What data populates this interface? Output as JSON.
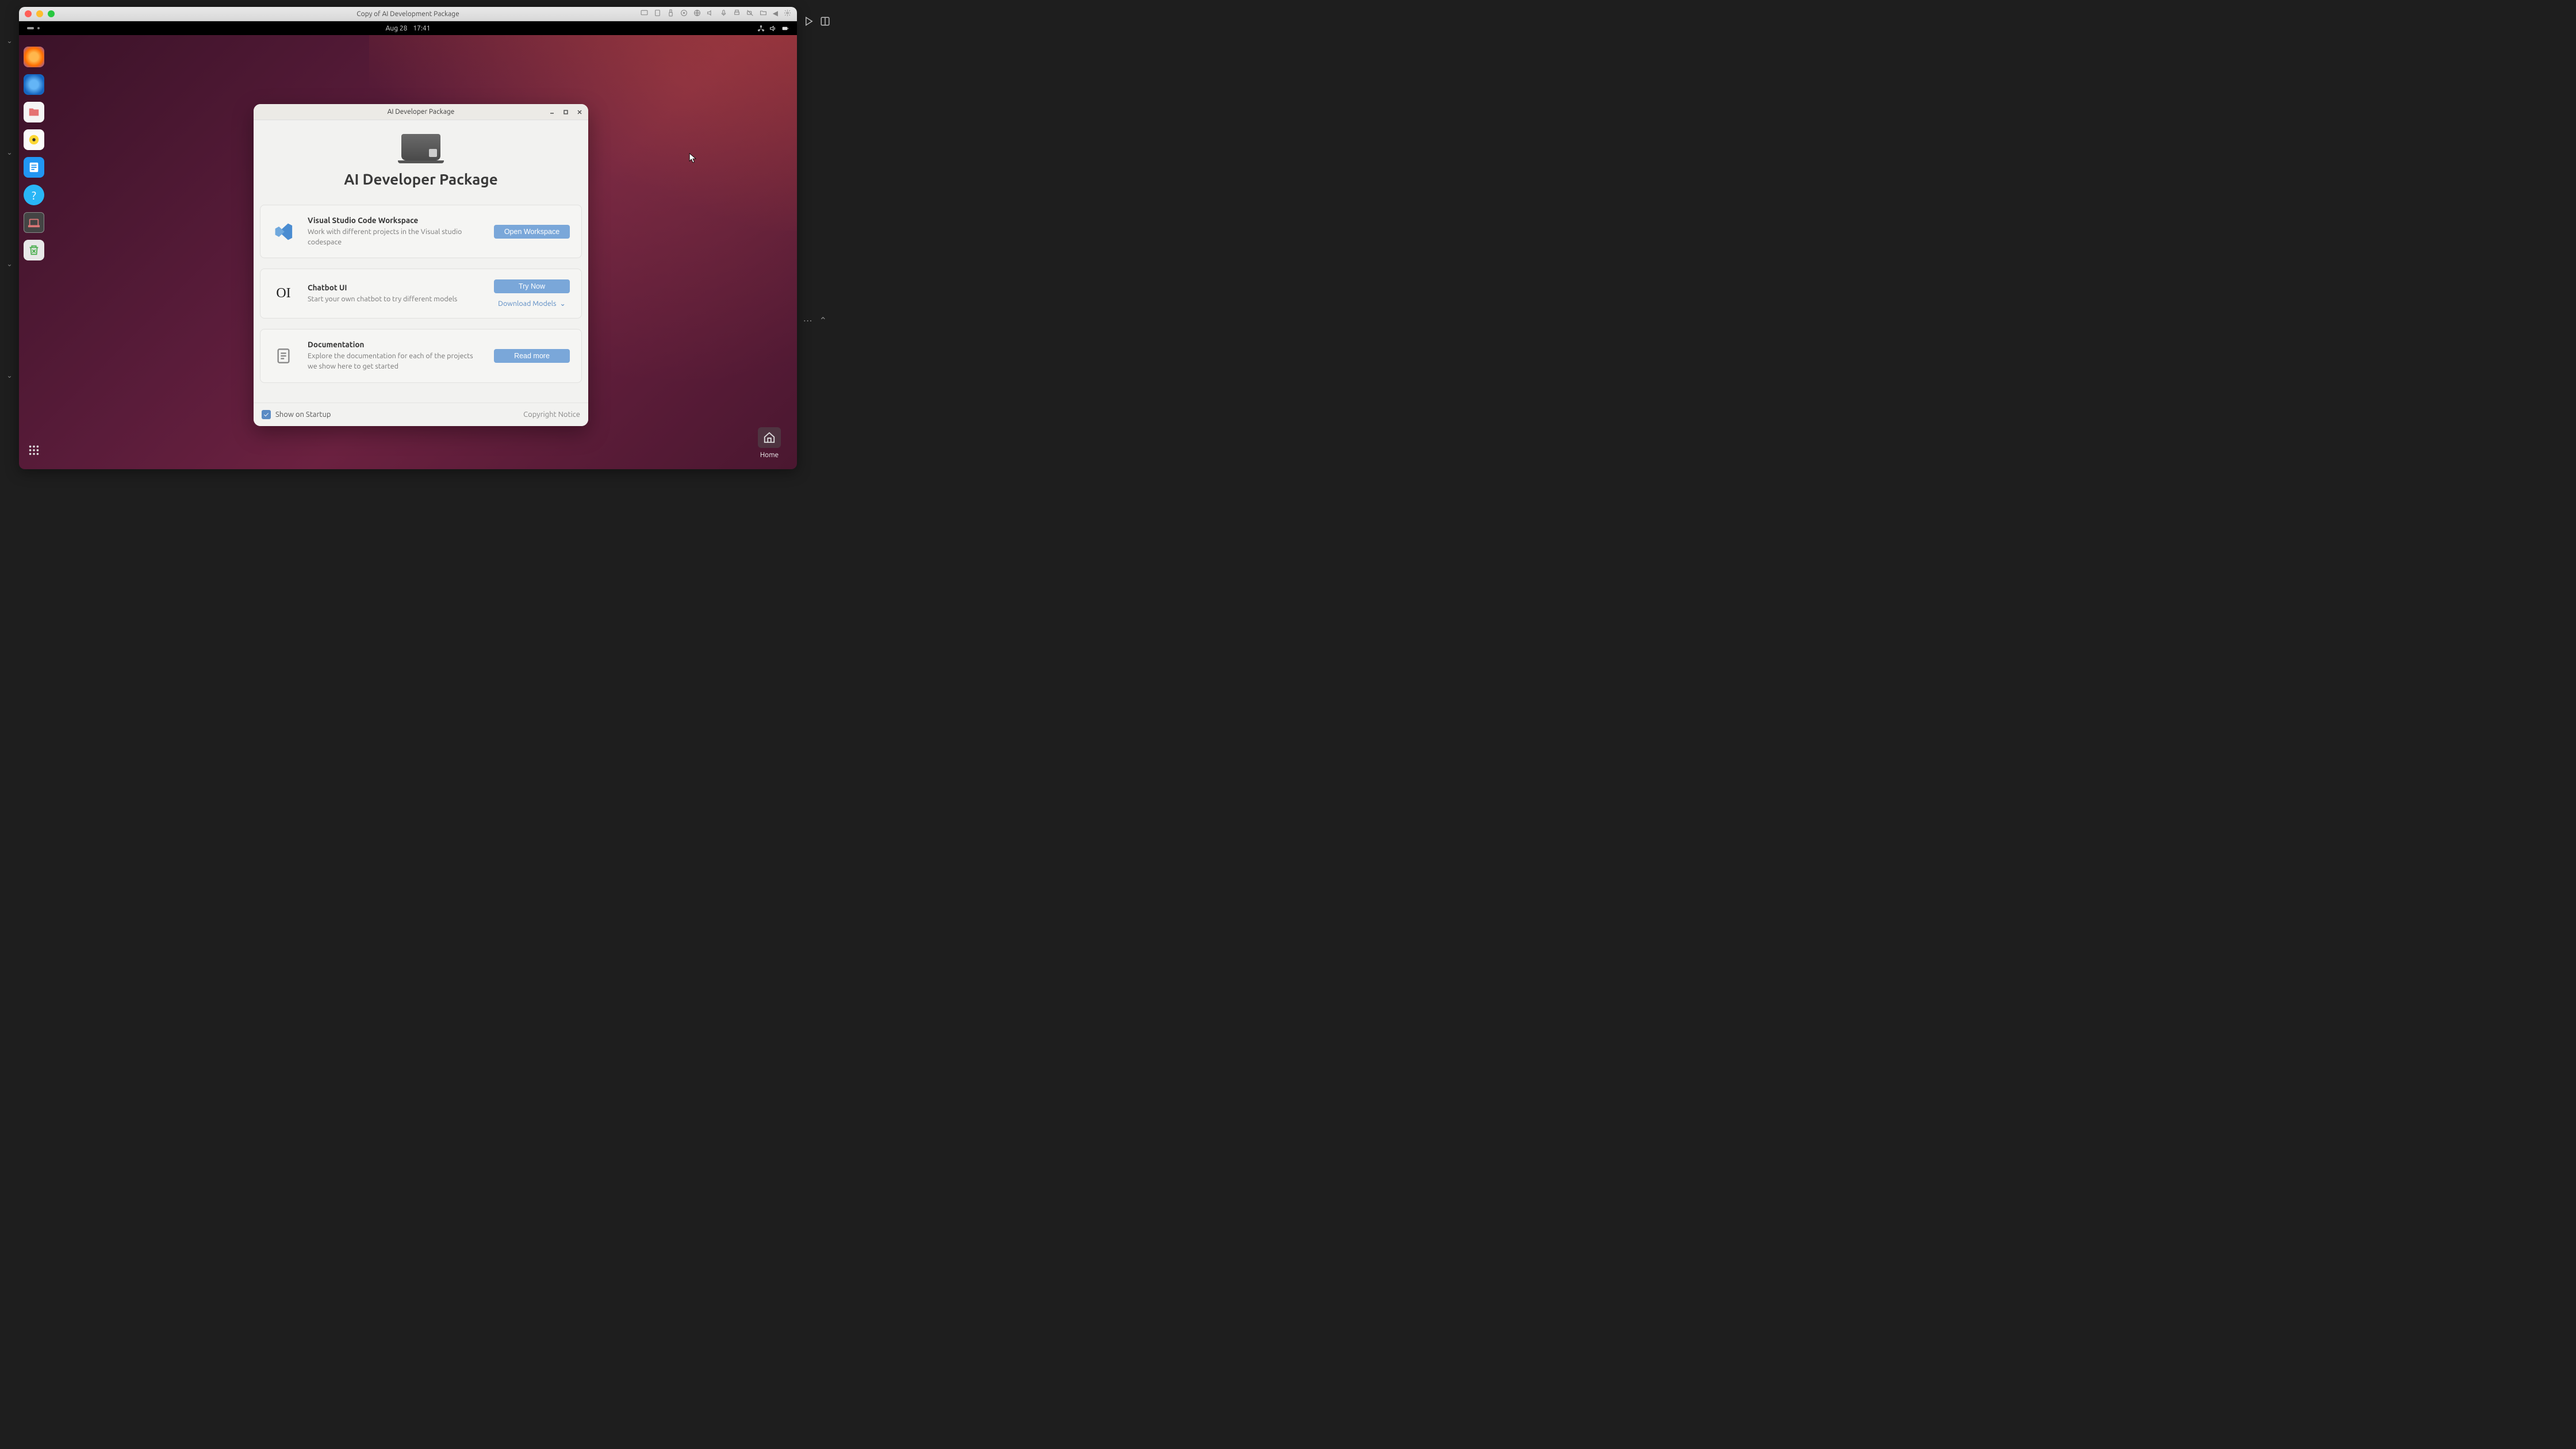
{
  "mac_titlebar": {
    "title": "Copy of AI Development Package"
  },
  "ubuntu_topbar": {
    "date": "Aug 28",
    "time": "17:41"
  },
  "desktop": {
    "home_label": "Home"
  },
  "dialog": {
    "titlebar": "AI Developer Package",
    "hero_title": "AI Developer Package",
    "cards": {
      "vscode": {
        "title": "Visual Studio Code Workspace",
        "subtitle": "Work with different projects in the Visual studio codespace",
        "button": "Open Workspace"
      },
      "chatbot": {
        "title": "Chatbot UI",
        "subtitle": "Start your own chatbot to try different models",
        "button": "Try Now",
        "download_link": "Download Models"
      },
      "docs": {
        "title": "Documentation",
        "subtitle": "Explore the documentation for each of the projects we show here to get started",
        "button": "Read more"
      }
    },
    "footer": {
      "show_startup": "Show on Startup",
      "copyright": "Copyright Notice"
    }
  }
}
